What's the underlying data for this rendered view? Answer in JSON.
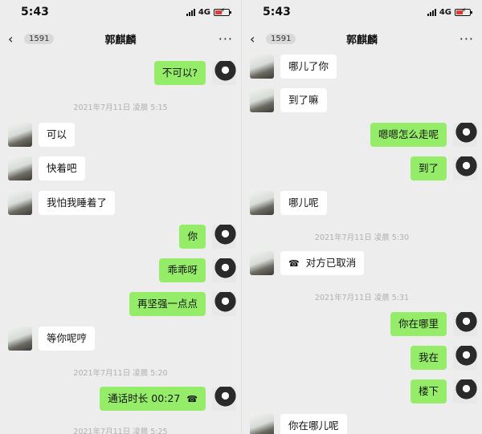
{
  "left": {
    "status": {
      "time": "5:43",
      "network": "4G"
    },
    "nav": {
      "back_count": "1591",
      "title": "郭麒麟"
    },
    "messages": [
      {
        "side": "self",
        "text": "不可以?"
      },
      {
        "side": "peer",
        "text": "可以"
      },
      {
        "side": "peer",
        "text": "快着吧"
      },
      {
        "side": "peer",
        "text": "我怕我睡着了"
      },
      {
        "side": "self",
        "text": "你"
      },
      {
        "side": "self",
        "text": "乖乖呀"
      },
      {
        "side": "self",
        "text": "再坚强一点点"
      },
      {
        "side": "peer",
        "text": "等你呢哼"
      },
      {
        "side": "self",
        "text": "通话时长 00:27"
      }
    ],
    "timestamps": [
      "2021年7月11日 凌晨 5:15",
      "2021年7月11日 凌晨 5:20",
      "2021年7月11日 凌晨 5:25"
    ]
  },
  "right": {
    "status": {
      "time": "5:43",
      "network": "4G"
    },
    "nav": {
      "back_count": "1591",
      "title": "郭麒麟"
    },
    "messages": [
      {
        "side": "peer",
        "text": "哪儿了你"
      },
      {
        "side": "peer",
        "text": "到了嘛"
      },
      {
        "side": "self",
        "text": "嗯嗯怎么走呢"
      },
      {
        "side": "self",
        "text": "到了"
      },
      {
        "side": "peer",
        "text": "哪儿呢"
      },
      {
        "side": "peer",
        "text": "对方已取消"
      },
      {
        "side": "self",
        "text": "你在哪里"
      },
      {
        "side": "self",
        "text": "我在"
      },
      {
        "side": "self",
        "text": "楼下"
      },
      {
        "side": "peer",
        "text": "你在哪儿呢"
      }
    ],
    "timestamps": [
      "2021年7月11日 凌晨 5:30",
      "2021年7月11日 凌晨 5:31"
    ]
  },
  "colors": {
    "self_bubble": "#95ec69",
    "peer_bubble": "#ffffff",
    "background": "#ededed"
  },
  "icons": {
    "call": "phone-handset-icon",
    "back": "chevron-left-icon",
    "more": "ellipsis-icon"
  }
}
